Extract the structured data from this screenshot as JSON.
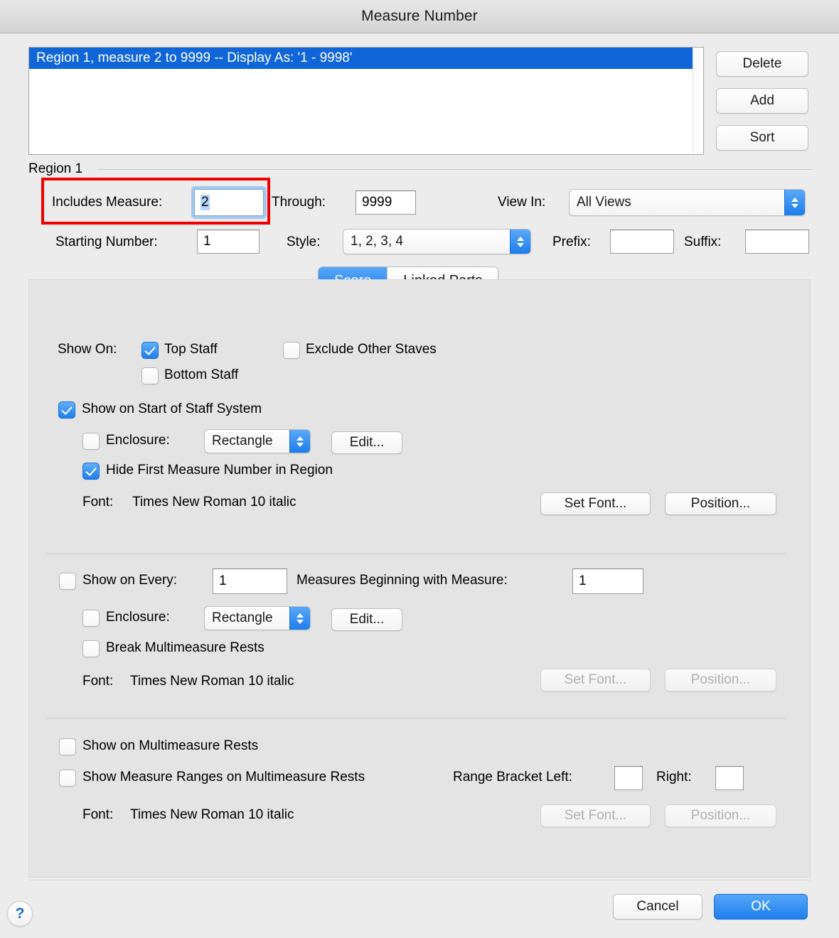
{
  "window": {
    "title": "Measure Number"
  },
  "region_list": {
    "rows": [
      {
        "text": "Region   1, measure    2 to 9999 -- Display As: '1 - 9998'",
        "selected": true
      }
    ],
    "buttons": {
      "delete": "Delete",
      "add": "Add",
      "sort": "Sort"
    }
  },
  "region_section": {
    "title": "Region 1",
    "highlight_color": "#ee0000",
    "includes_measure": {
      "label": "Includes Measure:",
      "value": "2",
      "focused": true
    },
    "through": {
      "label": "Through:",
      "value": "9999"
    },
    "view_in": {
      "label": "View In:",
      "value": "All Views"
    },
    "starting_number": {
      "label": "Starting Number:",
      "value": "1"
    },
    "style": {
      "label": "Style:",
      "value": "1, 2, 3, 4"
    },
    "prefix": {
      "label": "Prefix:",
      "value": ""
    },
    "suffix": {
      "label": "Suffix:",
      "value": ""
    }
  },
  "tabs": [
    {
      "label": "Score",
      "active": true
    },
    {
      "label": "Linked Parts",
      "active": false
    }
  ],
  "score_panel": {
    "show_on": {
      "label": "Show On:",
      "top_staff": {
        "label": "Top Staff",
        "checked": true
      },
      "exclude_other_staves": {
        "label": "Exclude Other Staves",
        "checked": false
      },
      "bottom_staff": {
        "label": "Bottom Staff",
        "checked": false
      }
    },
    "group_start": {
      "show_on_start": {
        "label": "Show on Start of Staff System",
        "checked": true
      },
      "enclosure": {
        "label": "Enclosure:",
        "checked": false,
        "value": "Rectangle"
      },
      "edit_button": "Edit...",
      "hide_first": {
        "label": "Hide First Measure Number in Region",
        "checked": true
      },
      "font_label": "Font:",
      "font_value": "Times New Roman 10  italic",
      "set_font_button": "Set Font...",
      "position_button": "Position...",
      "buttons_disabled": false
    },
    "group_every": {
      "show_on_every": {
        "label": "Show on Every:",
        "checked": false,
        "value": "1"
      },
      "measures_beginning": {
        "label": "Measures Beginning with Measure:",
        "value": "1"
      },
      "enclosure": {
        "label": "Enclosure:",
        "checked": false,
        "value": "Rectangle"
      },
      "edit_button": "Edit...",
      "break_multimeasure": {
        "label": "Break Multimeasure Rests",
        "checked": false
      },
      "font_label": "Font:",
      "font_value": "Times New Roman 10  italic",
      "set_font_button": "Set Font...",
      "position_button": "Position...",
      "buttons_disabled": true
    },
    "group_multimeasure": {
      "show_on_multimeasure": {
        "label": "Show on Multimeasure Rests",
        "checked": false
      },
      "show_ranges": {
        "label": "Show Measure Ranges on Multimeasure Rests",
        "checked": false
      },
      "range_bracket_left": {
        "label": "Range Bracket Left:",
        "value": ""
      },
      "range_bracket_right": {
        "label": "Right:",
        "value": ""
      },
      "font_label": "Font:",
      "font_value": "Times New Roman 10  italic",
      "set_font_button": "Set Font...",
      "position_button": "Position...",
      "buttons_disabled": true
    }
  },
  "footer": {
    "help": "?",
    "cancel": "Cancel",
    "ok": "OK"
  }
}
